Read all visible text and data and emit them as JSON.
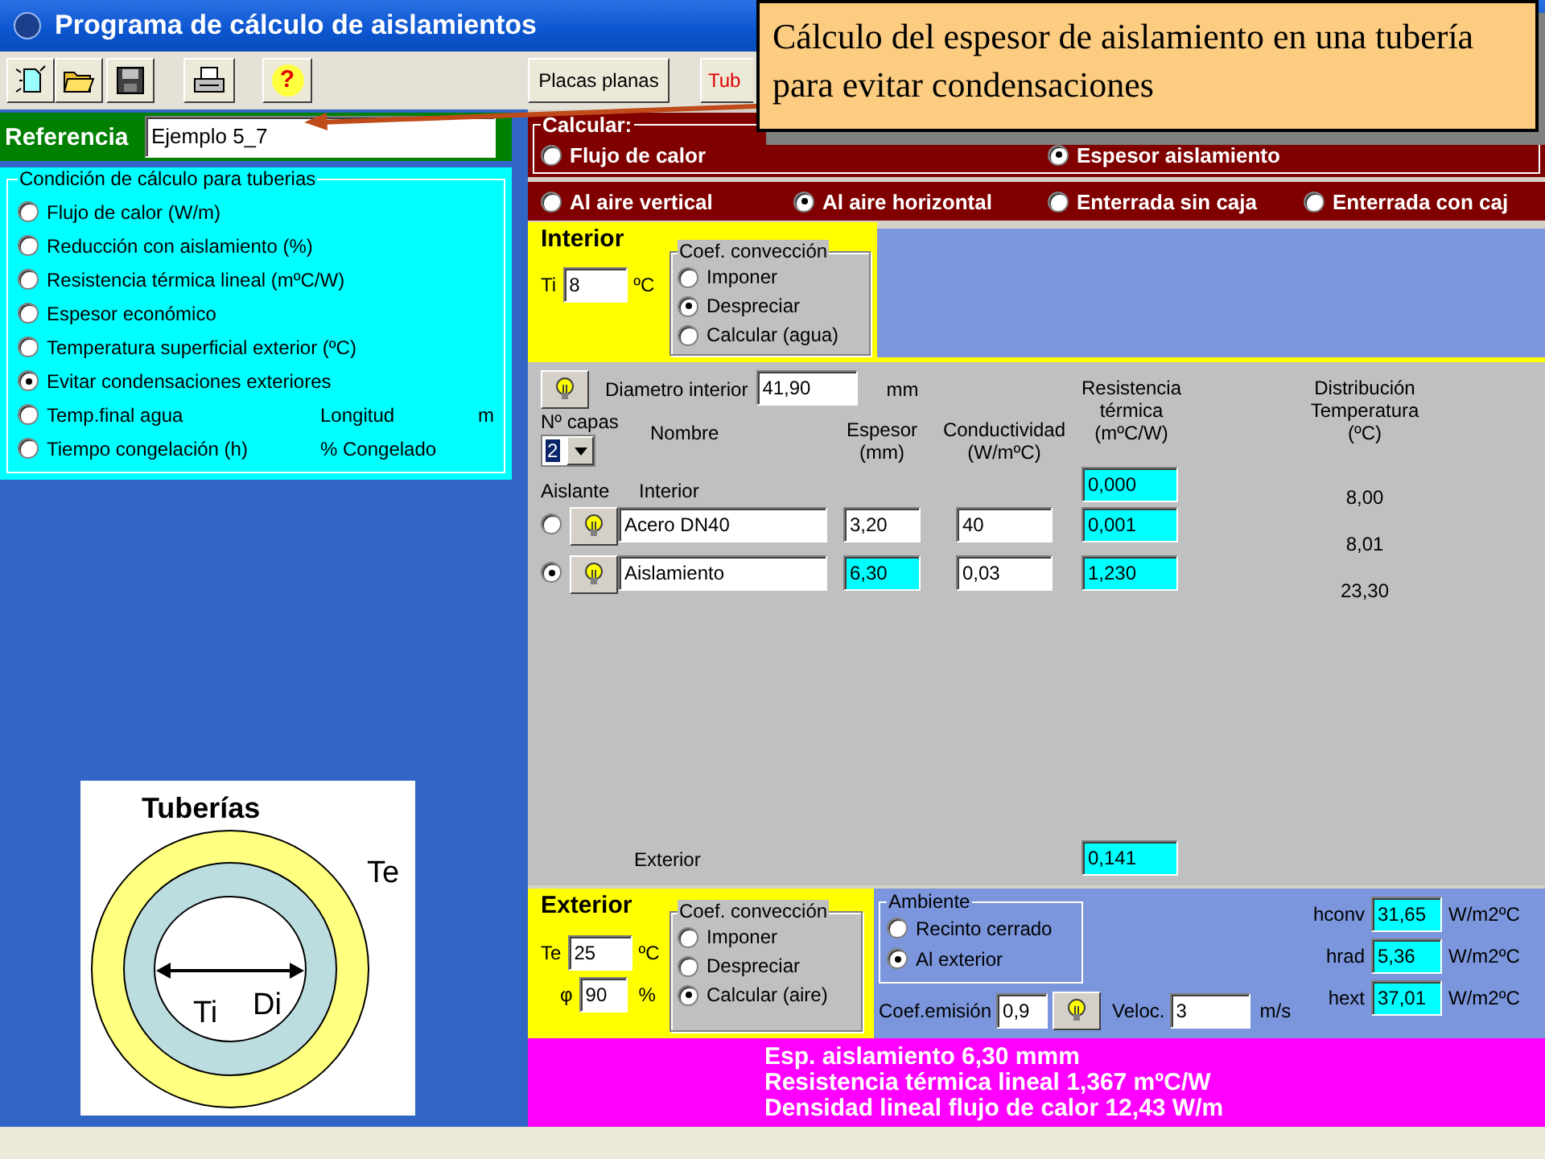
{
  "window": {
    "title": "Programa de cálculo de aislamientos"
  },
  "toolbar": {
    "help_glyph": "?"
  },
  "tabs": [
    {
      "label": "Placas planas",
      "selected": false
    },
    {
      "label": "Tub",
      "selected": true
    }
  ],
  "callout": {
    "text": "Cálculo del espesor de aislamiento en una tubería para evitar condensaciones"
  },
  "reference": {
    "label": "Referencia",
    "value": "Ejemplo 5_7"
  },
  "conditions": {
    "legend": "Condición de cálculo para tuberias",
    "options": [
      {
        "label": "Flujo de calor (W/m)",
        "selected": false
      },
      {
        "label": "Reducción con aislamiento (%)",
        "selected": false
      },
      {
        "label": "Resistencia térmica lineal (mºC/W)",
        "selected": false
      },
      {
        "label": "Espesor económico",
        "selected": false
      },
      {
        "label": "Temperatura superficial exterior (ºC)",
        "selected": false
      },
      {
        "label": "Evitar condensaciones exteriores",
        "selected": true
      },
      {
        "label": "Temp.final agua",
        "selected": false,
        "extras": [
          "Longitud",
          "m"
        ]
      },
      {
        "label": "Tiempo congelación (h)",
        "selected": false,
        "extras": [
          "% Congelado"
        ]
      }
    ]
  },
  "diagram": {
    "title": "Tuberías",
    "outer_label": "Te",
    "inner_label": "Ti",
    "diameter_label": "Di"
  },
  "calculate": {
    "legend": "Calcular:",
    "options": [
      {
        "label": "Flujo de calor",
        "selected": false
      },
      {
        "label": "Espesor aislamiento",
        "selected": true
      }
    ]
  },
  "placement": {
    "options": [
      {
        "label": "Al aire vertical",
        "selected": false
      },
      {
        "label": "Al aire horizontal",
        "selected": true
      },
      {
        "label": "Enterrada sin caja",
        "selected": false
      },
      {
        "label": "Enterrada con caj",
        "selected": false
      }
    ]
  },
  "interior": {
    "title": "Interior",
    "temp_label": "Ti",
    "temp_value": "8",
    "temp_unit": "ºC",
    "convection": {
      "legend": "Coef. convección",
      "options": [
        {
          "label": "Imponer",
          "selected": false
        },
        {
          "label": "Despreciar",
          "selected": true
        },
        {
          "label": "Calcular (agua)",
          "selected": false
        }
      ]
    }
  },
  "layers": {
    "diameter_label": "Diametro interior",
    "diameter_value": "41,90",
    "diameter_unit": "mm",
    "count_label": "Nº capas",
    "count_value": "2",
    "headers": {
      "name": "Nombre",
      "thickness": "Espesor\n(mm)",
      "conductivity": "Conductividad\n(W/mºC)",
      "resistance": "Resistencia\ntérmica\n(mºC/W)",
      "distribution": "Distribución\nTemperatura\n(ºC)"
    },
    "insulator_label": "Aislante",
    "interior_label": "Interior",
    "interior_resistance": "0,000",
    "rows": [
      {
        "selected": false,
        "name": "Acero DN40",
        "thickness": "3,20",
        "thickness_computed": false,
        "conductivity": "40",
        "resistance": "0,001"
      },
      {
        "selected": true,
        "name": "Aislamiento",
        "thickness": "6,30",
        "thickness_computed": true,
        "conductivity": "0,03",
        "resistance": "1,230"
      }
    ],
    "temperatures": [
      "8,00",
      "8,01",
      "23,30"
    ],
    "exterior_label": "Exterior",
    "exterior_resistance": "0,141"
  },
  "exterior": {
    "title": "Exterior",
    "temp_label": "Te",
    "temp_value": "25",
    "temp_unit": "ºC",
    "humidity_label": "φ",
    "humidity_value": "90",
    "humidity_unit": "%",
    "convection": {
      "legend": "Coef. convección",
      "options": [
        {
          "label": "Imponer",
          "selected": false
        },
        {
          "label": "Despreciar",
          "selected": false
        },
        {
          "label": "Calcular (aire)",
          "selected": true
        }
      ]
    },
    "ambient": {
      "legend": "Ambiente",
      "options": [
        {
          "label": "Recinto cerrado",
          "selected": false
        },
        {
          "label": "Al exterior",
          "selected": true
        }
      ]
    },
    "emission_label": "Coef.emisión",
    "emission_value": "0,9",
    "velocity_label": "Veloc.",
    "velocity_value": "3",
    "velocity_unit": "m/s",
    "coefficients": [
      {
        "label": "hconv",
        "value": "31,65",
        "unit": "W/m2ºC"
      },
      {
        "label": "hrad",
        "value": "5,36",
        "unit": "W/m2ºC"
      },
      {
        "label": "hext",
        "value": "37,01",
        "unit": "W/m2ºC"
      }
    ]
  },
  "results": [
    "Esp. aislamiento 6,30 mmm",
    "Resistencia térmica lineal 1,367 mºC/W",
    "Densidad lineal flujo de calor 12,43 W/m"
  ]
}
